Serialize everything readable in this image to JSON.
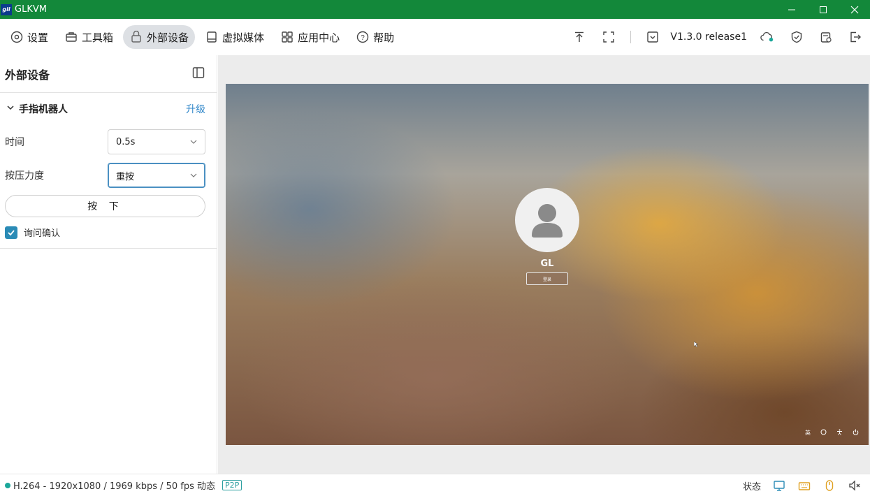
{
  "window": {
    "title": "GLKVM",
    "logo_text": "gli"
  },
  "menu": {
    "items": [
      {
        "label": "设置",
        "icon": "settings-icon"
      },
      {
        "label": "工具箱",
        "icon": "toolbox-icon"
      },
      {
        "label": "外部设备",
        "icon": "device-icon"
      },
      {
        "label": "虚拟媒体",
        "icon": "media-icon"
      },
      {
        "label": "应用中心",
        "icon": "apps-icon"
      },
      {
        "label": "帮助",
        "icon": "help-icon"
      }
    ],
    "active": "外部设备",
    "version": "V1.3.0 release1"
  },
  "sidebar": {
    "title": "外部设备",
    "section_title": "手指机器人",
    "upgrade_label": "升级",
    "time_label": "时间",
    "time_value": "0.5s",
    "pressure_label": "按压力度",
    "pressure_value": "重按",
    "press_button": "按 下",
    "confirm_label": "询问确认",
    "confirm_checked": true
  },
  "remote_screen": {
    "user_name": "GL",
    "login_button": "登录",
    "lang_indicator": "英"
  },
  "statusbar": {
    "stream_info": "H.264 - 1920x1080 /  1969 kbps / 50 fps 动态",
    "p2p_badge": "P2P",
    "status_label": "状态"
  },
  "colors": {
    "title_bar": "#13883a",
    "accent": "#2a8bb6",
    "link": "#2f86c9",
    "status_dot": "#1ba79a"
  }
}
